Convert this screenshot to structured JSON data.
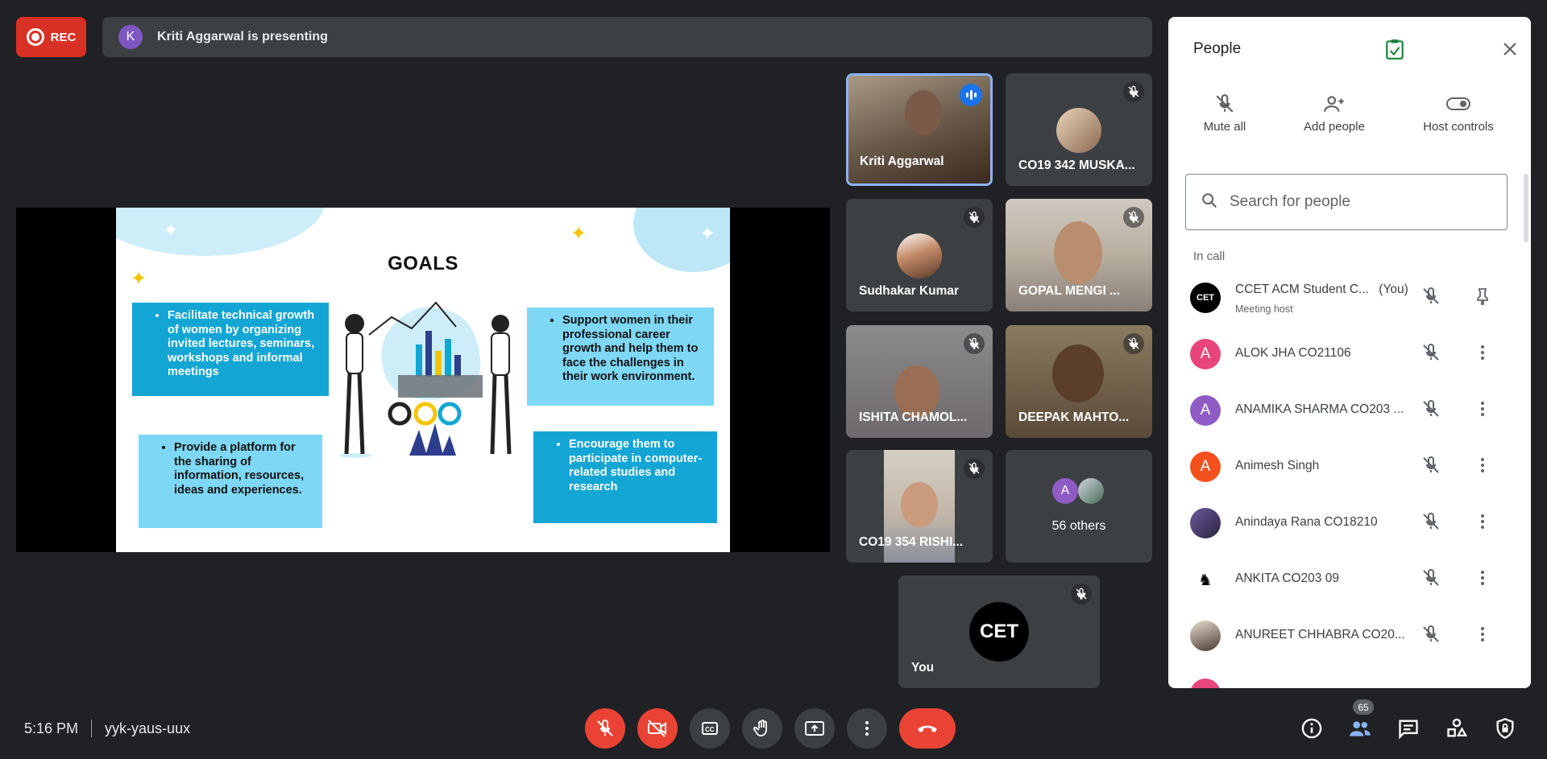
{
  "top_bar": {
    "rec_label": "REC",
    "presenter_initial": "K",
    "presenting_text": "Kriti Aggarwal is presenting"
  },
  "slide": {
    "title": "GOALS",
    "points": [
      "Facilitate technical growth of women by organizing invited lectures, seminars, workshops and informal meetings",
      "Provide a platform for the sharing of information, resources, ideas and experiences.",
      "Support women in their professional career growth and help them to face the challenges in their work environment.",
      "Encourage them to participate in computer-related studies and research"
    ]
  },
  "tiles": [
    {
      "name": "Kriti Aggarwal"
    },
    {
      "name": "CO19 342 MUSKA..."
    },
    {
      "name": "Sudhakar Kumar"
    },
    {
      "name": "GOPAL MENGI ..."
    },
    {
      "name": "ISHITA CHAMOL..."
    },
    {
      "name": "DEEPAK MAHTO..."
    },
    {
      "name": "CO19 354 RISHI..."
    },
    {
      "name": "56 others",
      "initial": "A"
    },
    {
      "name": "You",
      "logo_text": "CET"
    }
  ],
  "panel": {
    "title": "People",
    "actions": [
      "Mute all",
      "Add people",
      "Host controls"
    ],
    "search_placeholder": "Search for people",
    "section_label": "In call",
    "people": [
      {
        "name": "CCET ACM Student C...",
        "you": "(You)",
        "sub": "Meeting host",
        "avatar_text": "CET",
        "color": "#000000"
      },
      {
        "name": "ALOK JHA CO21106",
        "initial": "A",
        "color": "#e8457a"
      },
      {
        "name": "ANAMIKA SHARMA CO203 ...",
        "initial": "A",
        "color": "#8e5cc4"
      },
      {
        "name": "Animesh Singh",
        "initial": "A",
        "color": "#f4511e"
      },
      {
        "name": "Anindaya Rana CO18210",
        "color": "#4a3f6b"
      },
      {
        "name": "ANKITA CO203 09",
        "color": "#ffffff"
      },
      {
        "name": "ANUREET CHHABRA CO20...",
        "color": "#c9b7a8"
      }
    ]
  },
  "bottom": {
    "time": "5:16 PM",
    "meeting_code": "yyk-yaus-uux",
    "participant_count": "65"
  },
  "colors": {
    "background": "#202124",
    "danger": "#ea4335",
    "accent": "#1a73e8",
    "tile": "#3c4043"
  }
}
